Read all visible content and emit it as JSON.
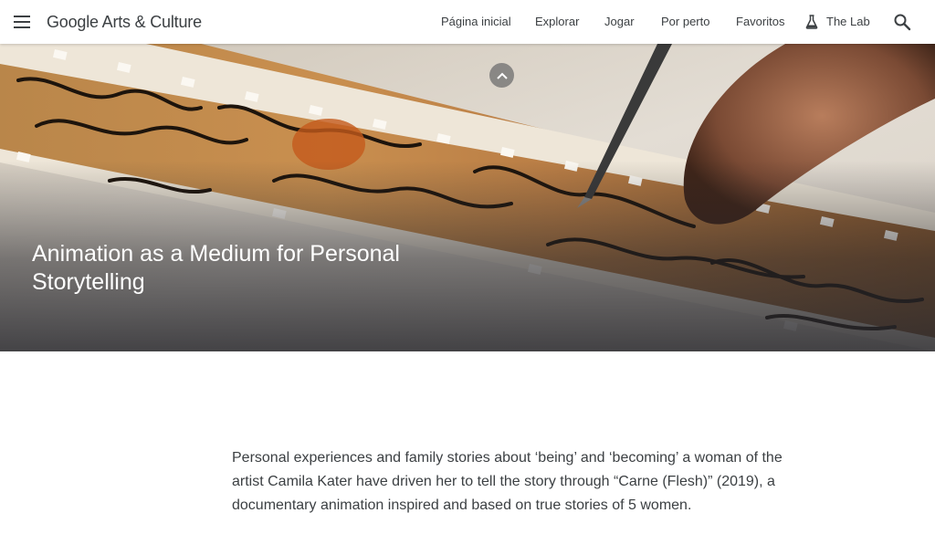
{
  "header": {
    "logo_text": "Google Arts & Culture",
    "nav": {
      "home": "Página inicial",
      "explore": "Explorar",
      "play": "Jogar",
      "nearby": "Por perto",
      "favorites": "Favoritos",
      "lab": "The Lab"
    },
    "icons": [
      "hamburger-menu-icon",
      "flask-icon",
      "search-icon"
    ]
  },
  "hero": {
    "title": "Animation as a Medium for Personal Storytelling",
    "scroll_up_icon": "chevron-up-icon"
  },
  "article": {
    "intro": "Personal experiences and family stories about ‘being’ and ‘becoming’ a woman of the artist Camila Kater have driven her to tell the story through “Carne (Flesh)” (2019), a documentary animation inspired and based on true stories of 5 women."
  }
}
